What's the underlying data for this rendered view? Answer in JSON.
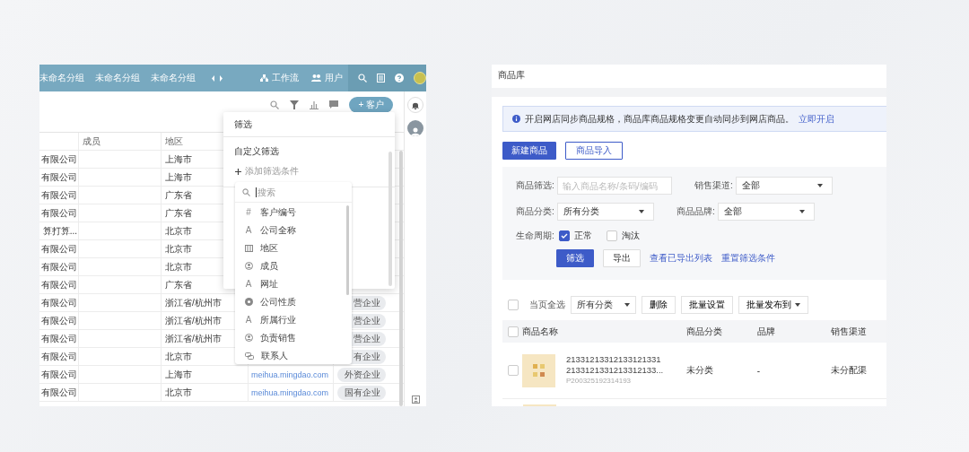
{
  "crm_app": {
    "top_bar": {
      "groups": [
        {
          "label": "未命名分组"
        },
        {
          "label": "未命名分组"
        },
        {
          "label": "未命名分组"
        }
      ],
      "nav": [
        {
          "kind": "workflow",
          "label": "工作流"
        },
        {
          "kind": "users",
          "label": "用户"
        }
      ]
    },
    "toolbar": {
      "add_button": "+ 客户"
    },
    "table": {
      "columns": [
        "成员",
        "地区"
      ],
      "rows": [
        {
          "name": "有限公司",
          "region": "上海市"
        },
        {
          "name": "有限公司",
          "region": "上海市"
        },
        {
          "name": "有限公司",
          "region": "广东省"
        },
        {
          "name": "有限公司",
          "region": "广东省"
        },
        {
          "name": "算打算...",
          "region": "北京市"
        },
        {
          "name": "有限公司",
          "region": "北京市"
        },
        {
          "name": "有限公司",
          "region": "北京市"
        },
        {
          "name": "有限公司",
          "region": "广东省"
        },
        {
          "name": "有限公司",
          "region": "浙江省/杭州市",
          "type": "营企业"
        },
        {
          "name": "有限公司",
          "region": "浙江省/杭州市",
          "type": "营企业"
        },
        {
          "name": "有限公司",
          "region": "浙江省/杭州市",
          "type": "营企业"
        },
        {
          "name": "有限公司",
          "region": "北京市",
          "type": "有企业"
        },
        {
          "name": "有限公司",
          "region": "上海市",
          "website": "meihua.mingdao.com",
          "type": "外资企业"
        },
        {
          "name": "有限公司",
          "region": "北京市",
          "website": "meihua.mingdao.com",
          "type": "国有企业"
        }
      ]
    },
    "filter_panel": {
      "title": "筛选",
      "section": "自定义筛选",
      "add_condition": "添加筛选条件",
      "search": {
        "placeholder": "搜索"
      },
      "fields": [
        {
          "glyph": "#",
          "label": "客户编号"
        },
        {
          "glyph": "A",
          "label": "公司全称"
        },
        {
          "kind": "region",
          "label": "地区"
        },
        {
          "kind": "member",
          "label": "成员"
        },
        {
          "glyph": "A",
          "label": "网址"
        },
        {
          "kind": "option",
          "label": "公司性质"
        },
        {
          "glyph": "A",
          "label": "所属行业"
        },
        {
          "kind": "member",
          "label": "负责销售"
        },
        {
          "kind": "relation",
          "label": "联系人"
        }
      ]
    }
  },
  "product_library": {
    "title": "商品库",
    "notice": {
      "text": "开启网店同步商品规格，商品库商品规格变更自动同步到网店商品。",
      "link": "立即开启"
    },
    "actions": [
      {
        "label": "新建商品",
        "primary": true
      },
      {
        "label": "商品导入",
        "primary": false
      }
    ],
    "filters": {
      "keyword": {
        "label": "商品筛选:",
        "placeholder": "输入商品名称/条码/编码"
      },
      "channel": {
        "label": "销售渠道:",
        "value": "全部"
      },
      "category": {
        "label": "商品分类:",
        "value": "所有分类"
      },
      "brand": {
        "label": "商品品牌:",
        "value": "全部"
      },
      "lifecycle": {
        "label": "生命周期:",
        "options": [
          {
            "label": "正常",
            "checked": true
          },
          {
            "label": "淘汰",
            "checked": false
          }
        ]
      },
      "buttons": [
        {
          "label": "筛选",
          "primary": true
        },
        {
          "label": "导出",
          "primary": false
        }
      ],
      "links": [
        "查看已导出列表",
        "重置筛选条件"
      ]
    },
    "bulk_bar": {
      "select_all": {
        "label": "当页全选",
        "checked": false
      },
      "category": "所有分类",
      "buttons": [
        {
          "label": "删除"
        },
        {
          "label": "批量设置"
        },
        {
          "label": "批量发布到",
          "dropdown": true
        }
      ]
    },
    "table": {
      "columns": [
        "商品名称",
        "商品分类",
        "品牌",
        "销售渠道"
      ],
      "header_checked": false,
      "rows": [
        {
          "checked": false,
          "name_lines": [
            "21331213312133121331",
            "2133121331213312133..."
          ],
          "code": "P200325192314193",
          "category": "未分类",
          "brand": "-",
          "channel": "未分配渠"
        }
      ]
    }
  }
}
